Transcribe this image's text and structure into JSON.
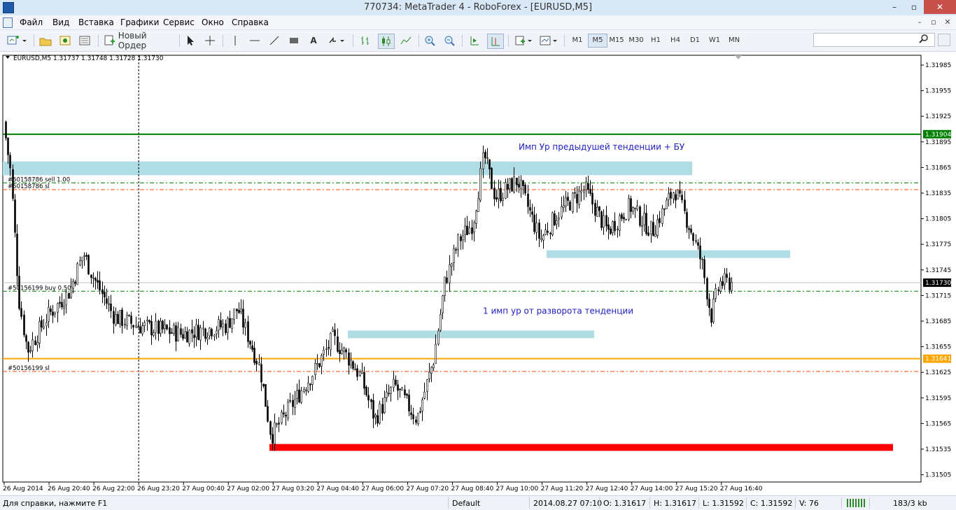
{
  "window": {
    "title": "770734: MetaTrader 4 - RoboForex - [EURUSD,M5]",
    "controls": [
      "–",
      "▫",
      "✕"
    ]
  },
  "menu": [
    "Файл",
    "Вид",
    "Вставка",
    "Графики",
    "Сервис",
    "Окно",
    "Справка"
  ],
  "mdi_controls": [
    "–",
    "▫",
    "✕"
  ],
  "toolbar": {
    "new_order_label": "Новый Ордер",
    "timeframes": [
      "M1",
      "M5",
      "M15",
      "M30",
      "H1",
      "H4",
      "D1",
      "W1",
      "MN"
    ],
    "active_timeframe": "M5",
    "search": {
      "value": "",
      "placeholder": ""
    }
  },
  "chart_data": {
    "type": "candlestick",
    "header": "EURUSD,M5  1.31737 1.31748 1.31728 1.31730",
    "symbol": "EURUSD",
    "timeframe": "M5",
    "ohlc_header": {
      "open": 1.31737,
      "high": 1.31748,
      "low": 1.31728,
      "close": 1.3173
    },
    "ylim": [
      1.3151,
      1.31995
    ],
    "y_ticks": [
      "1.31985",
      "1.31955",
      "1.31925",
      "1.31895",
      "1.31865",
      "1.31835",
      "1.31805",
      "1.31775",
      "1.31745",
      "1.31715",
      "1.31685",
      "1.31655",
      "1.31625",
      "1.31595",
      "1.31565",
      "1.31535",
      "1.31505"
    ],
    "x_ticks": [
      "26 Aug 2014",
      "26 Aug 20:40",
      "26 Aug 22:00",
      "26 Aug 23:20",
      "27 Aug 00:40",
      "27 Aug 02:00",
      "27 Aug 03:20",
      "27 Aug 04:40",
      "27 Aug 06:00",
      "27 Aug 07:20",
      "27 Aug 08:40",
      "27 Aug 10:00",
      "27 Aug 11:20",
      "27 Aug 12:40",
      "27 Aug 14:00",
      "27 Aug 15:20",
      "27 Aug 16:40"
    ],
    "price_labels": [
      {
        "text": "1.31904",
        "value": 1.31904,
        "color": "#008000"
      },
      {
        "text": "1.31730",
        "value": 1.3173,
        "color": "#000000"
      },
      {
        "text": "1.31641",
        "value": 1.31641,
        "color": "#ffa500"
      }
    ],
    "horizontal_lines": [
      {
        "value": 1.31904,
        "color": "#008000",
        "style": "solid",
        "width": 2
      },
      {
        "value": 1.31641,
        "color": "#ffa500",
        "style": "solid",
        "width": 2
      },
      {
        "value": 1.3173,
        "color": "#c0c0c0",
        "style": "solid",
        "width": 1
      },
      {
        "value": 1.31847,
        "color": "#008000",
        "style": "dashdot",
        "width": 1
      },
      {
        "value": 1.31839,
        "color": "#ff4500",
        "style": "dashdot",
        "width": 1
      },
      {
        "value": 1.3172,
        "color": "#008000",
        "style": "dashdot",
        "width": 1
      },
      {
        "value": 1.31626,
        "color": "#ff4500",
        "style": "dashdot",
        "width": 1
      }
    ],
    "trade_labels": [
      {
        "text": "#50158786 sell 1.00",
        "value": 1.31847
      },
      {
        "text": "#50158786 sl",
        "value": 1.31839
      },
      {
        "text": "#50156199 buy 0.50",
        "value": 1.3172
      },
      {
        "text": "#50156199 sl",
        "value": 1.31626
      }
    ],
    "zones": [
      {
        "from": "26 Aug 2014",
        "to": "27 Aug 15:20",
        "y_top": 1.31872,
        "y_bottom": 1.31856,
        "color": "#b0dde4"
      },
      {
        "from": "27 Aug 11:20",
        "to": "27 Aug 16:40",
        "y_top": 1.31768,
        "y_bottom": 1.31759,
        "color": "#b0dde4"
      },
      {
        "from": "27 Aug 04:40",
        "to": "27 Aug 10:00",
        "y_top": 1.31674,
        "y_bottom": 1.31665,
        "color": "#b0dde4"
      },
      {
        "from": "27 Aug 03:20",
        "to": "27 Aug 16:40",
        "y_top": 1.31541,
        "y_bottom": 1.31533,
        "color": "#ff0000"
      }
    ],
    "annotations": [
      {
        "text": "Имп Ур предыдушей тенденции + БУ",
        "color": "#2020c0",
        "value": 1.31889
      },
      {
        "text": "1 имп ур от разворота тенденции",
        "color": "#2020c0",
        "value": 1.31697
      }
    ],
    "vertical_marker": "26 Aug 23:20",
    "close_path": [
      {
        "time": "26 Aug 19:20",
        "price": 1.3193
      },
      {
        "time": "26 Aug 19:35",
        "price": 1.3186
      },
      {
        "time": "26 Aug 19:50",
        "price": 1.3171
      },
      {
        "time": "26 Aug 20:05",
        "price": 1.3165
      },
      {
        "time": "26 Aug 20:40",
        "price": 1.3169
      },
      {
        "time": "26 Aug 21:20",
        "price": 1.3172
      },
      {
        "time": "26 Aug 21:45",
        "price": 1.31765
      },
      {
        "time": "26 Aug 22:00",
        "price": 1.3174
      },
      {
        "time": "26 Aug 22:40",
        "price": 1.3169
      },
      {
        "time": "26 Aug 23:20",
        "price": 1.3168
      },
      {
        "time": "27 Aug 00:40",
        "price": 1.3167
      },
      {
        "time": "27 Aug 02:00",
        "price": 1.3168
      },
      {
        "time": "27 Aug 02:20",
        "price": 1.317
      },
      {
        "time": "27 Aug 03:00",
        "price": 1.3163
      },
      {
        "time": "27 Aug 03:20",
        "price": 1.3155
      },
      {
        "time": "27 Aug 03:50",
        "price": 1.3158
      },
      {
        "time": "27 Aug 04:40",
        "price": 1.3163
      },
      {
        "time": "27 Aug 05:10",
        "price": 1.31665
      },
      {
        "time": "27 Aug 05:40",
        "price": 1.3164
      },
      {
        "time": "27 Aug 06:00",
        "price": 1.3162
      },
      {
        "time": "27 Aug 06:25",
        "price": 1.3157
      },
      {
        "time": "27 Aug 07:00",
        "price": 1.3161
      },
      {
        "time": "27 Aug 07:40",
        "price": 1.3157
      },
      {
        "time": "27 Aug 08:10",
        "price": 1.3164
      },
      {
        "time": "27 Aug 08:30",
        "price": 1.3173
      },
      {
        "time": "27 Aug 08:55",
        "price": 1.3178
      },
      {
        "time": "27 Aug 09:20",
        "price": 1.318
      },
      {
        "time": "27 Aug 09:40",
        "price": 1.3188
      },
      {
        "time": "27 Aug 10:00",
        "price": 1.3183
      },
      {
        "time": "27 Aug 10:40",
        "price": 1.3185
      },
      {
        "time": "27 Aug 11:20",
        "price": 1.3178
      },
      {
        "time": "27 Aug 11:50",
        "price": 1.3181
      },
      {
        "time": "27 Aug 12:40",
        "price": 1.3184
      },
      {
        "time": "27 Aug 13:20",
        "price": 1.3179
      },
      {
        "time": "27 Aug 14:00",
        "price": 1.3182
      },
      {
        "time": "27 Aug 14:40",
        "price": 1.3179
      },
      {
        "time": "27 Aug 15:20",
        "price": 1.3184
      },
      {
        "time": "27 Aug 15:50",
        "price": 1.3179
      },
      {
        "time": "27 Aug 16:10",
        "price": 1.3175
      },
      {
        "time": "27 Aug 16:25",
        "price": 1.3169
      },
      {
        "time": "27 Aug 16:40",
        "price": 1.3173
      }
    ]
  },
  "status": {
    "help": "Для справки, нажмите F1",
    "profile": "Default",
    "datetime": "2014.08.27 07:10",
    "open": "O: 1.31617",
    "high": "H: 1.31617",
    "low": "L: 1.31592",
    "close": "C: 1.31592",
    "volume": "V: 76",
    "traffic": "183/3 kb"
  },
  "colors": {
    "bull_candle": "#ffffff",
    "bear_candle": "#000000",
    "grid_vline": "#000000"
  }
}
